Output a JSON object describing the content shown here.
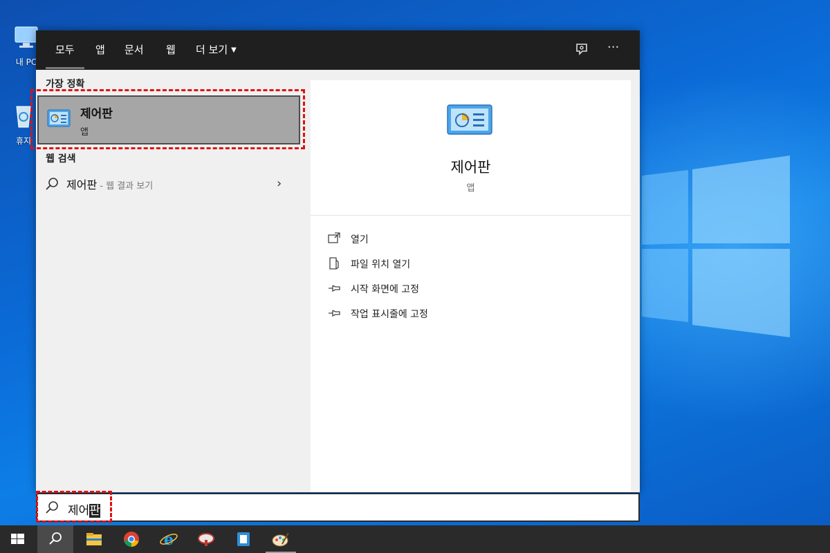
{
  "desktop": {
    "icons": [
      {
        "label": "내 PC",
        "icon": "computer-icon"
      },
      {
        "label": "휴지",
        "icon": "recycle-bin-icon"
      }
    ]
  },
  "search_panel": {
    "tabs": [
      {
        "label": "모두",
        "active": true
      },
      {
        "label": "앱"
      },
      {
        "label": "문서"
      },
      {
        "label": "웹"
      },
      {
        "label": "더 보기"
      }
    ],
    "top_icons": [
      "feedback-icon",
      "more-options-icon"
    ],
    "more_glyph": "···",
    "best_match": {
      "heading": "가장 정확",
      "title": "제어판",
      "subtitle": "앱",
      "icon": "control-panel-icon"
    },
    "web_search": {
      "heading": "웹 검색",
      "query": "제어판",
      "suffix": " - 웹 결과 보기"
    },
    "detail": {
      "title": "제어판",
      "subtitle": "앱",
      "actions": [
        {
          "label": "열기",
          "icon": "open-icon"
        },
        {
          "label": "파일 위치 열기",
          "icon": "file-location-icon"
        },
        {
          "label": "시작 화면에 고정",
          "icon": "pin-icon"
        },
        {
          "label": "작업 표시줄에 고정",
          "icon": "pin-icon"
        }
      ]
    }
  },
  "search_box": {
    "typed": "제어",
    "selected": "판"
  },
  "taskbar": {
    "items": [
      "windows-start-icon",
      "search-icon",
      "file-explorer-icon",
      "chrome-icon",
      "internet-explorer-icon",
      "app-icon",
      "notes-app-icon",
      "paint-app-icon"
    ]
  },
  "colors": {
    "highlight": "#e01010",
    "panel_dark": "#1f1f1f",
    "taskbar": "#2a2a2a"
  }
}
